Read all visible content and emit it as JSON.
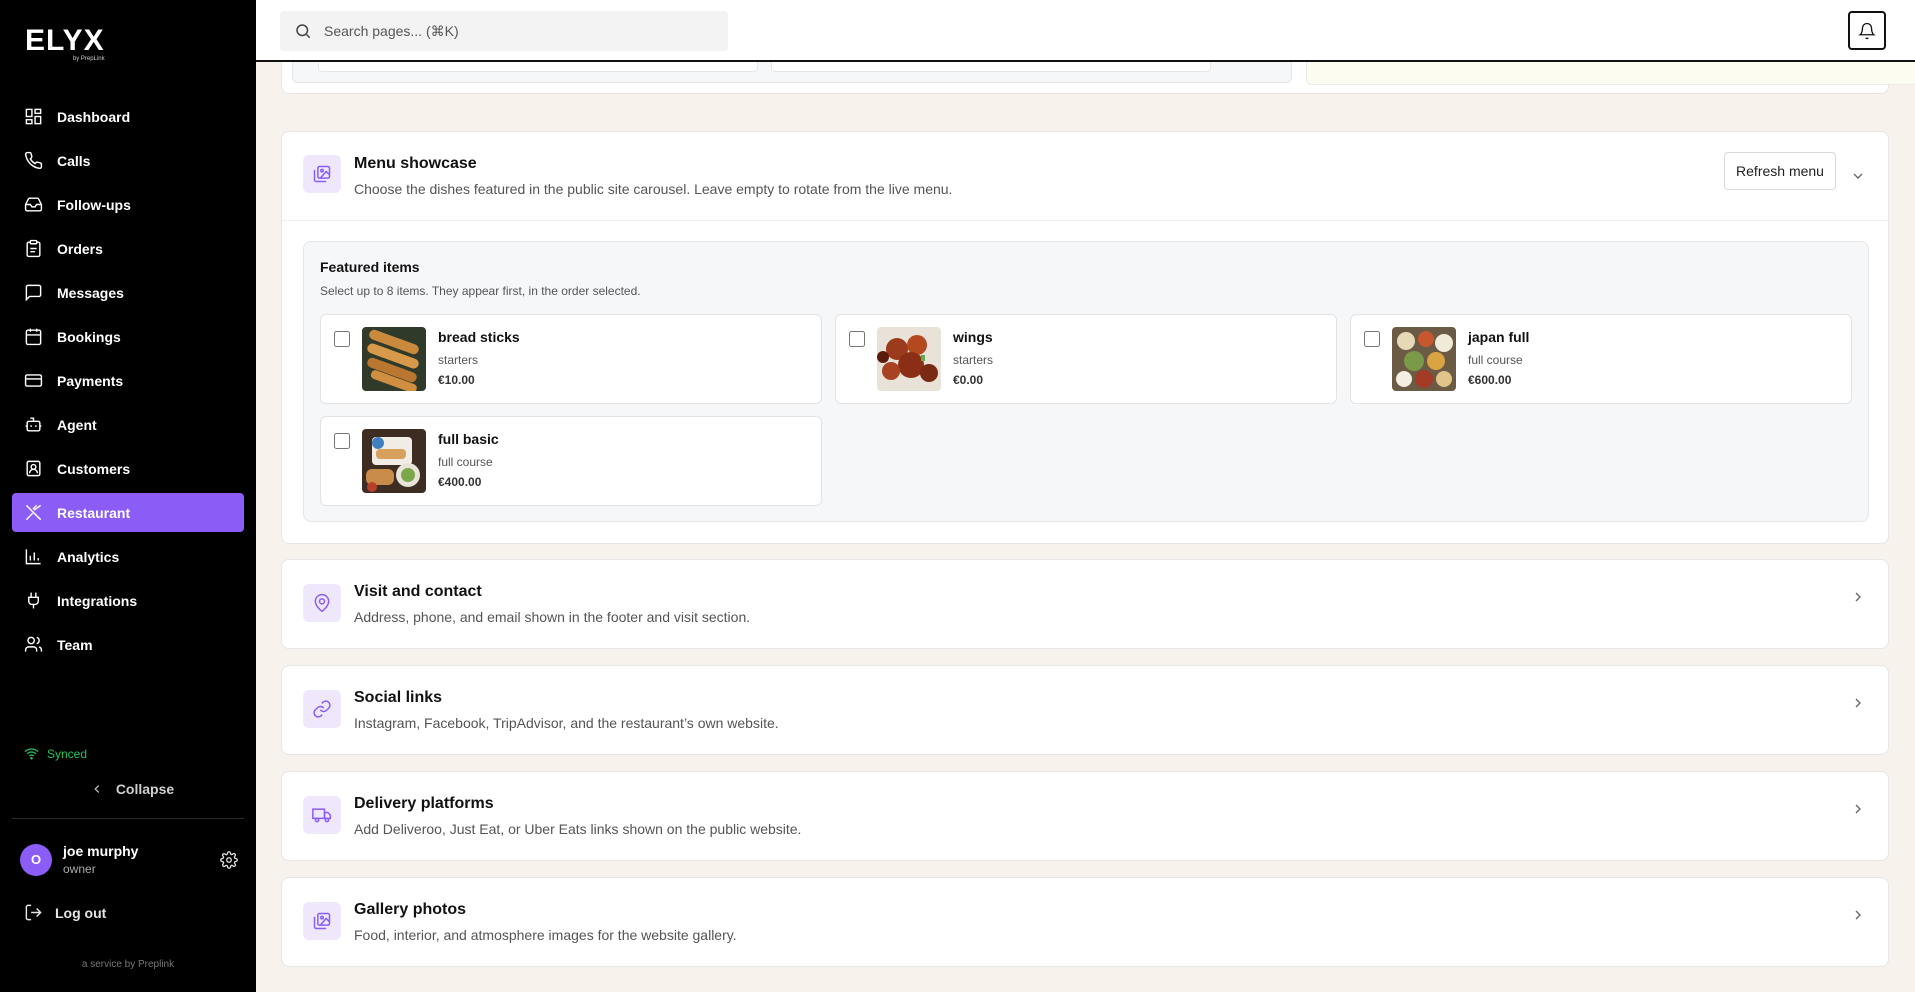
{
  "brand": {
    "name": "ELYX",
    "sub": "by PrepLink"
  },
  "search": {
    "placeholder": "Search pages... (⌘K)"
  },
  "sidebar": {
    "items": [
      {
        "label": "Dashboard",
        "icon": "dashboard-icon"
      },
      {
        "label": "Calls",
        "icon": "phone-icon"
      },
      {
        "label": "Follow-ups",
        "icon": "inbox-icon"
      },
      {
        "label": "Orders",
        "icon": "clipboard-icon"
      },
      {
        "label": "Messages",
        "icon": "message-icon"
      },
      {
        "label": "Bookings",
        "icon": "calendar-icon"
      },
      {
        "label": "Payments",
        "icon": "credit-card-icon"
      },
      {
        "label": "Agent",
        "icon": "bot-icon"
      },
      {
        "label": "Customers",
        "icon": "contact-icon"
      },
      {
        "label": "Restaurant",
        "icon": "utensils-icon",
        "active": true
      },
      {
        "label": "Analytics",
        "icon": "bar-chart-icon"
      },
      {
        "label": "Integrations",
        "icon": "plug-icon"
      },
      {
        "label": "Team",
        "icon": "users-icon"
      }
    ],
    "synced": "Synced",
    "collapse": "Collapse",
    "user": {
      "initial": "O",
      "name": "joe murphy",
      "role": "owner"
    },
    "logout": "Log out",
    "service": "a service by Preplink"
  },
  "colors": {
    "accent": "#8b5cf6",
    "accent_soft": "#efe8fd",
    "synced": "#22c55e",
    "page_bg": "#f7f2ec"
  },
  "menu_showcase": {
    "title": "Menu showcase",
    "description": "Choose the dishes featured in the public site carousel. Leave empty to rotate from the live menu.",
    "refresh_label": "Refresh menu",
    "featured_title": "Featured items",
    "featured_subtitle": "Select up to 8 items. They appear first, in the order selected.",
    "items": [
      {
        "name": "bread sticks",
        "category": "starters",
        "price": "€10.00"
      },
      {
        "name": "wings",
        "category": "starters",
        "price": "€0.00"
      },
      {
        "name": "japan full",
        "category": "full course",
        "price": "€600.00"
      },
      {
        "name": "full basic",
        "category": "full course",
        "price": "€400.00"
      }
    ]
  },
  "sections": [
    {
      "title": "Visit and contact",
      "description": "Address, phone, and email shown in the footer and visit section.",
      "icon": "map-pin-icon"
    },
    {
      "title": "Social links",
      "description": "Instagram, Facebook, TripAdvisor, and the restaurant’s own website.",
      "icon": "link-icon"
    },
    {
      "title": "Delivery platforms",
      "description": "Add Deliveroo, Just Eat, or Uber Eats links shown on the public website.",
      "icon": "truck-icon"
    },
    {
      "title": "Gallery photos",
      "description": "Food, interior, and atmosphere images for the website gallery.",
      "icon": "images-icon"
    }
  ]
}
